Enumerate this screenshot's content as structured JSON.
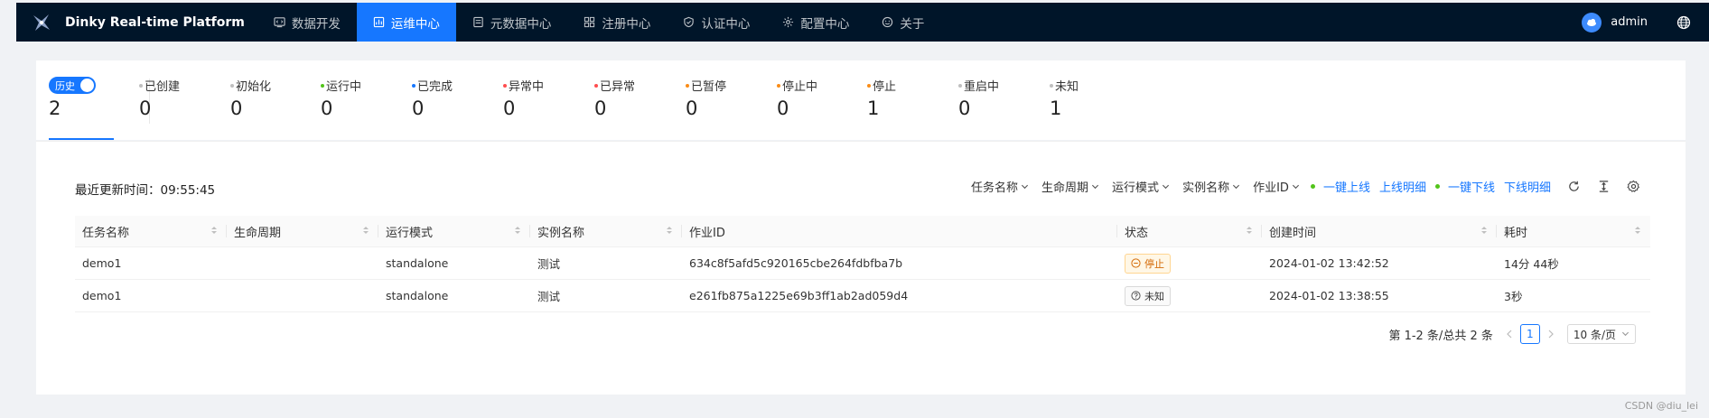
{
  "nav": {
    "brand": "Dinky Real-time Platform",
    "items": [
      {
        "label": "数据开发",
        "icon": "code-icon"
      },
      {
        "label": "运维中心",
        "icon": "dashboard-icon"
      },
      {
        "label": "元数据中心",
        "icon": "database-icon"
      },
      {
        "label": "注册中心",
        "icon": "apps-icon"
      },
      {
        "label": "认证中心",
        "icon": "shield-icon"
      },
      {
        "label": "配置中心",
        "icon": "gear-icon"
      },
      {
        "label": "关于",
        "icon": "smile-icon"
      }
    ],
    "active_index": 1,
    "user": "admin"
  },
  "stats": {
    "history_label": "历史",
    "history_value": "2",
    "items": [
      {
        "label": "已创建",
        "value": "0",
        "color": "#bfbfbf"
      },
      {
        "label": "初始化",
        "value": "0",
        "color": "#bfbfbf"
      },
      {
        "label": "运行中",
        "value": "0",
        "color": "#52c41a"
      },
      {
        "label": "已完成",
        "value": "0",
        "color": "#1677ff"
      },
      {
        "label": "异常中",
        "value": "0",
        "color": "#ff4d4f"
      },
      {
        "label": "已异常",
        "value": "0",
        "color": "#ff4d4f"
      },
      {
        "label": "已暂停",
        "value": "0",
        "color": "#fa8c16"
      },
      {
        "label": "停止中",
        "value": "0",
        "color": "#fa8c16"
      },
      {
        "label": "停止",
        "value": "1",
        "color": "#fa8c16"
      },
      {
        "label": "重启中",
        "value": "0",
        "color": "#bfbfbf"
      },
      {
        "label": "未知",
        "value": "1",
        "color": "#bfbfbf"
      }
    ]
  },
  "table": {
    "update_label": "最近更新时间：",
    "update_time": "09:55:45",
    "filters": [
      "任务名称",
      "生命周期",
      "运行模式",
      "实例名称",
      "作业ID"
    ],
    "links": [
      {
        "primary": "一键上线",
        "secondary": "上线明细"
      },
      {
        "primary": "一键下线",
        "secondary": "下线明细"
      }
    ],
    "columns": [
      "任务名称",
      "生命周期",
      "运行模式",
      "实例名称",
      "作业ID",
      "状态",
      "创建时间",
      "耗时"
    ],
    "rows": [
      {
        "name": "demo1",
        "lifecycle": "",
        "mode": "standalone",
        "instance": "测试",
        "job_id": "634c8f5afd5c920165cbe264fdbfba7b",
        "status": "停止",
        "status_type": "stop",
        "created": "2024-01-02 13:42:52",
        "duration": "14分 44秒"
      },
      {
        "name": "demo1",
        "lifecycle": "",
        "mode": "standalone",
        "instance": "测试",
        "job_id": "e261fb875a1225e69b3ff1ab2ad059d4",
        "status": "未知",
        "status_type": "unknown",
        "created": "2024-01-02 13:38:55",
        "duration": "3秒"
      }
    ]
  },
  "pagination": {
    "summary": "第 1-2 条/总共 2 条",
    "current": "1",
    "page_size": "10 条/页"
  },
  "watermark": "CSDN @diu_lei"
}
